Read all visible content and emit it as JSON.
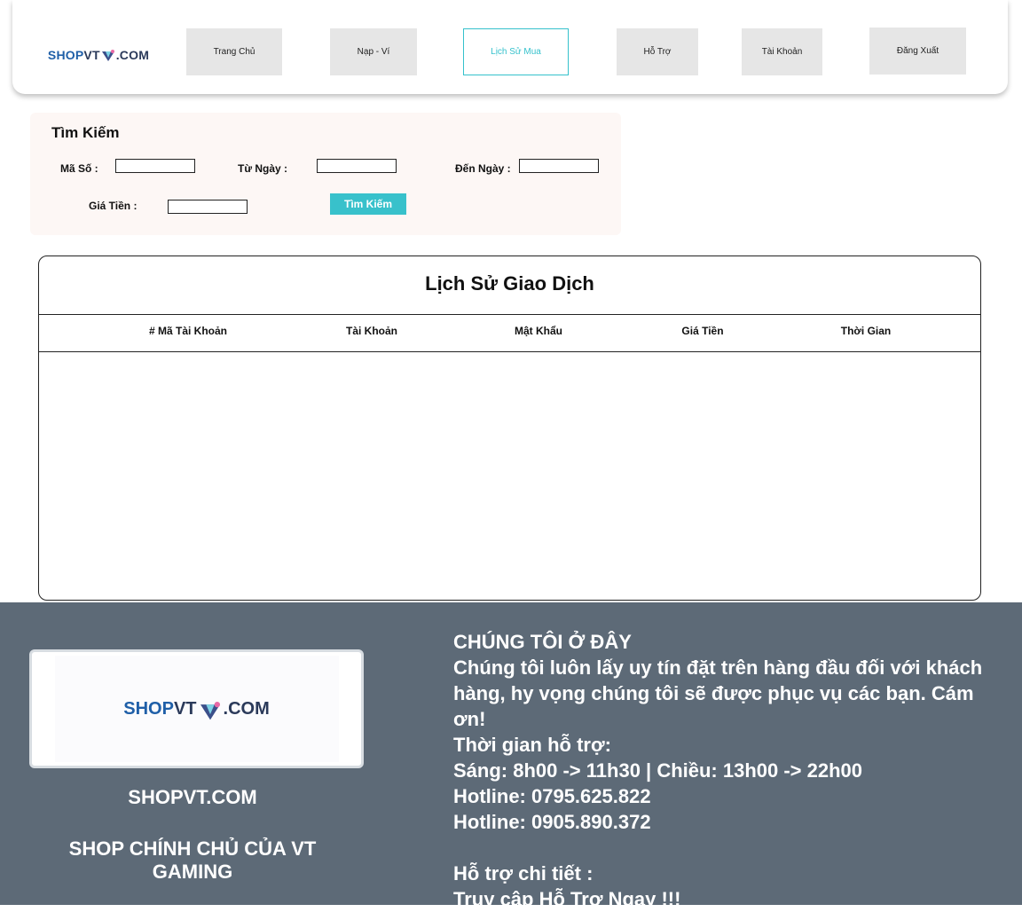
{
  "brand": {
    "logo": {
      "shop": "SHOP",
      "vt": "VT",
      "com": ".COM"
    }
  },
  "nav": {
    "home": "Trang Chủ",
    "wallet": "Nạp - Ví",
    "purchase_history": "Lịch Sử Mua",
    "support": "Hỗ Trợ",
    "account": "Tài Khoản",
    "logout": "Đăng Xuất",
    "active": "purchase_history"
  },
  "search": {
    "title": "Tìm Kiếm",
    "id_label": "Mã Số :",
    "id_value": "",
    "from_label": "Từ Ngày :",
    "from_value": "",
    "to_label": "Đến Ngày :",
    "to_value": "",
    "price_label": "Giá Tiền :",
    "price_value": "",
    "button_label": "Tìm Kiếm"
  },
  "history": {
    "title": "Lịch Sử Giao Dịch",
    "columns": [
      "# Mã Tài Khoản",
      "Tài Khoản",
      "Mật Khẩu",
      "Giá Tiền",
      "Thời Gian"
    ],
    "rows": []
  },
  "footer": {
    "site_name": "SHOPVT.COM",
    "tagline": "SHOP CHÍNH CHỦ CỦA VT GAMING",
    "heading": "CHÚNG TÔI Ở ĐÂY",
    "message": "Chúng tôi luôn lấy uy tín đặt trên hàng đầu đối với khách hàng, hy vọng chúng tôi sẽ được phục vụ các bạn. Cám ơn!",
    "hours_label": "Thời gian hỗ trợ:",
    "hours": "Sáng: 8h00 -> 11h30 | Chiều: 13h00 -> 22h00",
    "hotline1": "Hotline: 0795.625.822",
    "hotline2": "Hotline: 0905.890.372",
    "detail_label": "Hỗ trợ chi tiết :",
    "access_prefix": "Truy cập ",
    "access_link": "Hỗ Trợ Ngay !!!"
  },
  "colors": {
    "accent": "#38c1cb",
    "footer_bg": "#5d6a77",
    "nav_bg": "#e6e6e6"
  }
}
